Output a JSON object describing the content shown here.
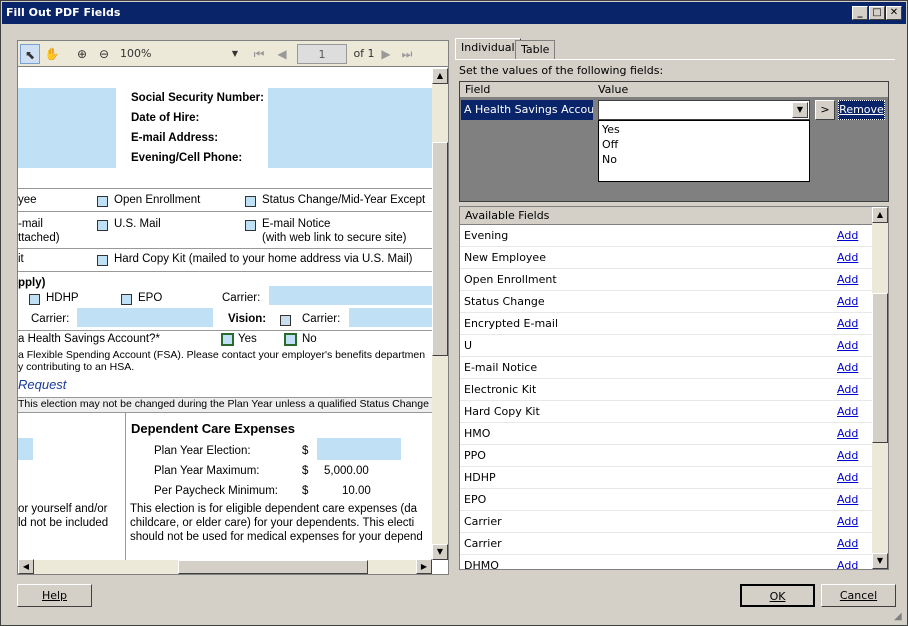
{
  "window": {
    "title": "Fill Out PDF Fields"
  },
  "viewer": {
    "zoom": "100%",
    "page": "1",
    "page_of": "of 1"
  },
  "doc": {
    "ssn": "Social Security Number:",
    "hire": "Date of Hire:",
    "email": "E-mail Address:",
    "phone": "Evening/Cell Phone:",
    "yee": "yee",
    "open_enroll": "Open Enrollment",
    "status_change": "Status Change/Mid-Year Except",
    "c_mail": "-mail",
    "attached": "ttached)",
    "usmail": "U.S. Mail",
    "enotice": "E-mail Notice",
    "enotice2": "(with web link to secure site)",
    "it": "it",
    "hardcopy": "Hard Copy Kit (mailed to your home address via U.S. Mail)",
    "pply": "pply)",
    "hdhp": "HDHP",
    "epo": "EPO",
    "carrier1": "Carrier:",
    "carrier2": "Carrier:",
    "vision": "Vision:",
    "carrier3": "Carrier:",
    "hsa_q": "a Health Savings Account?*",
    "yes": "Yes",
    "no": "No",
    "fsa1": "a Flexible Spending Account (FSA).  Please contact your employer's benefits departmen",
    "fsa2": "y contributing to an HSA.",
    "request": "Request",
    "election_note": "This election may not be changed during the Plan Year unless a qualified Status Change occurs.",
    "dce": "Dependent Care Expenses",
    "pye": "Plan Year Election:",
    "pym": "Plan Year Maximum:",
    "ppm": "Per Paycheck Minimum:",
    "dollar": "$",
    "pym_val": "5,000.00",
    "ppm_val": "10.00",
    "l1": "or yourself and/or",
    "l2": "ld not be included",
    "r1": "This election is for eligible dependent care expenses (da",
    "r2": "childcare, or elder care) for your dependents.  This electi",
    "r3": "should not be used for medical expenses for your depend"
  },
  "tabs": {
    "individual": "Individual",
    "table": "Table"
  },
  "set_label": "Set the values of the following fields:",
  "grid": {
    "field_header": "Field",
    "value_header": "Value",
    "field": "A Health Savings Account",
    "value": "",
    "arrow": ">",
    "remove": "Remove",
    "options": [
      "Yes",
      "Off",
      "No"
    ]
  },
  "available": {
    "header": "Available Fields",
    "add": "Add",
    "fields": [
      "Evening",
      "New Employee",
      "Open Enrollment",
      "Status Change",
      "Encrypted E-mail",
      "U",
      "E-mail Notice",
      "Electronic Kit",
      "Hard Copy Kit",
      "HMO",
      "PPO",
      "HDHP",
      "EPO",
      "Carrier",
      "Carrier",
      "DHMO"
    ]
  },
  "buttons": {
    "help": "Help",
    "ok": "OK",
    "cancel": "Cancel"
  }
}
